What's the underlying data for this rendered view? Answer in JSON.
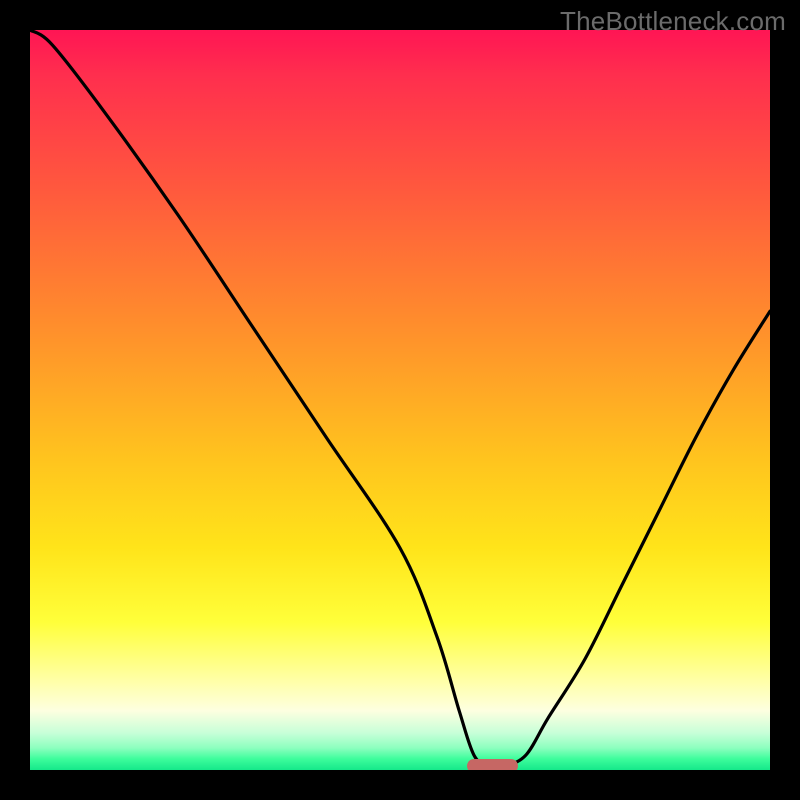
{
  "watermark": "TheBottleneck.com",
  "colors": {
    "background": "#000000",
    "curve": "#000000",
    "marker": "#c66764",
    "gradient_top": "#ff1554",
    "gradient_bottom": "#15e88a"
  },
  "chart_data": {
    "type": "line",
    "title": "",
    "xlabel": "",
    "ylabel": "",
    "xlim": [
      0,
      100
    ],
    "ylim": [
      0,
      100
    ],
    "x": [
      0,
      3,
      10,
      20,
      30,
      40,
      50,
      55,
      58,
      60,
      62,
      64,
      67,
      70,
      75,
      80,
      85,
      90,
      95,
      100
    ],
    "values": [
      100,
      98,
      89,
      75,
      60,
      45,
      30,
      18,
      8,
      2,
      0.5,
      0.5,
      2,
      7,
      15,
      25,
      35,
      45,
      54,
      62
    ],
    "marker": {
      "x_start": 59,
      "x_end": 66,
      "y": 0.5
    },
    "annotations": [
      "TheBottleneck.com"
    ]
  }
}
